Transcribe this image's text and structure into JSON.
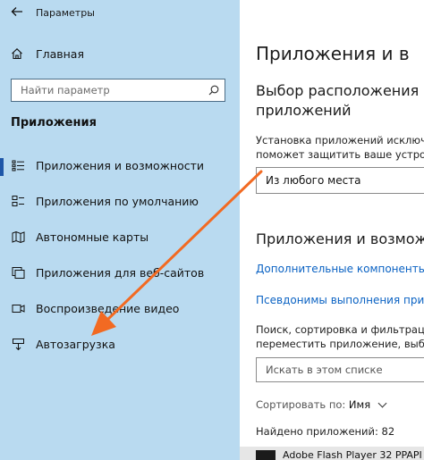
{
  "window": {
    "title": "Параметры"
  },
  "sidebar": {
    "home_label": "Главная",
    "search_placeholder": "Найти параметр",
    "section_title": "Приложения",
    "items": [
      {
        "label": "Приложения и возможности",
        "icon": "apps-list-icon",
        "active": true
      },
      {
        "label": "Приложения по умолчанию",
        "icon": "default-apps-icon",
        "active": false
      },
      {
        "label": "Автономные карты",
        "icon": "offline-maps-icon",
        "active": false
      },
      {
        "label": "Приложения для веб-сайтов",
        "icon": "websites-apps-icon",
        "active": false
      },
      {
        "label": "Воспроизведение видео",
        "icon": "video-playback-icon",
        "active": false
      },
      {
        "label": "Автозагрузка",
        "icon": "startup-icon",
        "active": false
      }
    ]
  },
  "main": {
    "page_title": "Приложения и в",
    "install_heading_line1": "Выбор расположения дл",
    "install_heading_line2": "приложений",
    "install_desc_line1": "Установка приложений исключ",
    "install_desc_line2": "поможет защитить ваше устрой",
    "install_source_value": "Из любого места",
    "apps_heading": "Приложения и возможн",
    "optional_features_link": "Дополнительные компоненты",
    "aliases_link": "Псевдонимы выполнения прило",
    "list_desc_line1": "Поиск, сортировка и фильтрац",
    "list_desc_line2": "переместить приложение, выбер",
    "list_search_placeholder": "Искать в этом списке",
    "sort_label": "Сортировать по:",
    "sort_value": "Имя",
    "found_text": "Найдено приложений: 82",
    "first_app_name": "Adobe Flash Player 32 PPAPI"
  },
  "colors": {
    "sidebar_bg": "#b9daf0",
    "accent": "#1e56a8",
    "link": "#0a62c3",
    "annotation_arrow": "#f26a22"
  }
}
